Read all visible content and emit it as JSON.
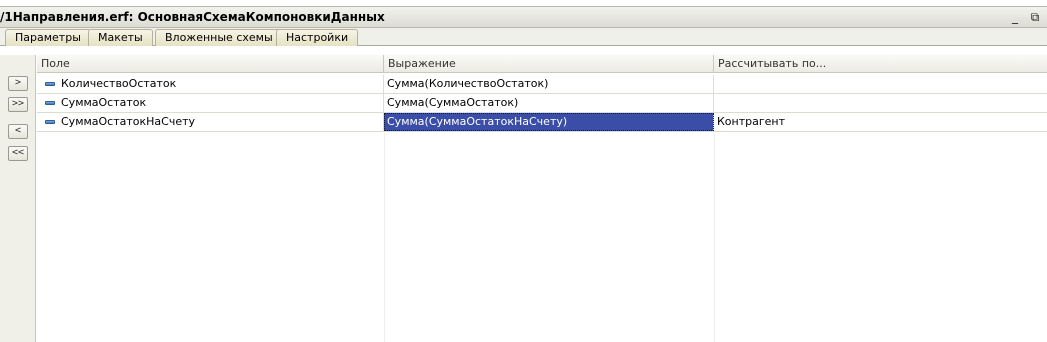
{
  "window": {
    "title": "/1Направления.erf: ОсновнаяСхемаКомпоновкиДанных",
    "minimize_label": "_",
    "restore_label": "⧉"
  },
  "tabs": [
    {
      "label": "Параметры"
    },
    {
      "label": "Макеты"
    },
    {
      "label": "Вложенные схемы"
    },
    {
      "label": "Настройки"
    }
  ],
  "side_buttons": [
    {
      "label": ">"
    },
    {
      "label": ">>"
    },
    {
      "label": "<"
    },
    {
      "label": "<<"
    }
  ],
  "grid": {
    "columns": [
      "Поле",
      "Выражение",
      "Рассчитывать по..."
    ],
    "rows": [
      {
        "field": "КоличествоОстаток",
        "expression": "Сумма(КоличествоОстаток)",
        "calc_by": ""
      },
      {
        "field": "СуммаОстаток",
        "expression": "Сумма(СуммаОстаток)",
        "calc_by": ""
      },
      {
        "field": "СуммаОстатокНаСчету",
        "expression": "Сумма(СуммаОстатокНаСчету)",
        "calc_by": "Контрагент"
      }
    ]
  },
  "icons": {
    "field_icon": "resource-field-icon",
    "minimize": "minimize-icon",
    "restore": "restore-icon"
  }
}
